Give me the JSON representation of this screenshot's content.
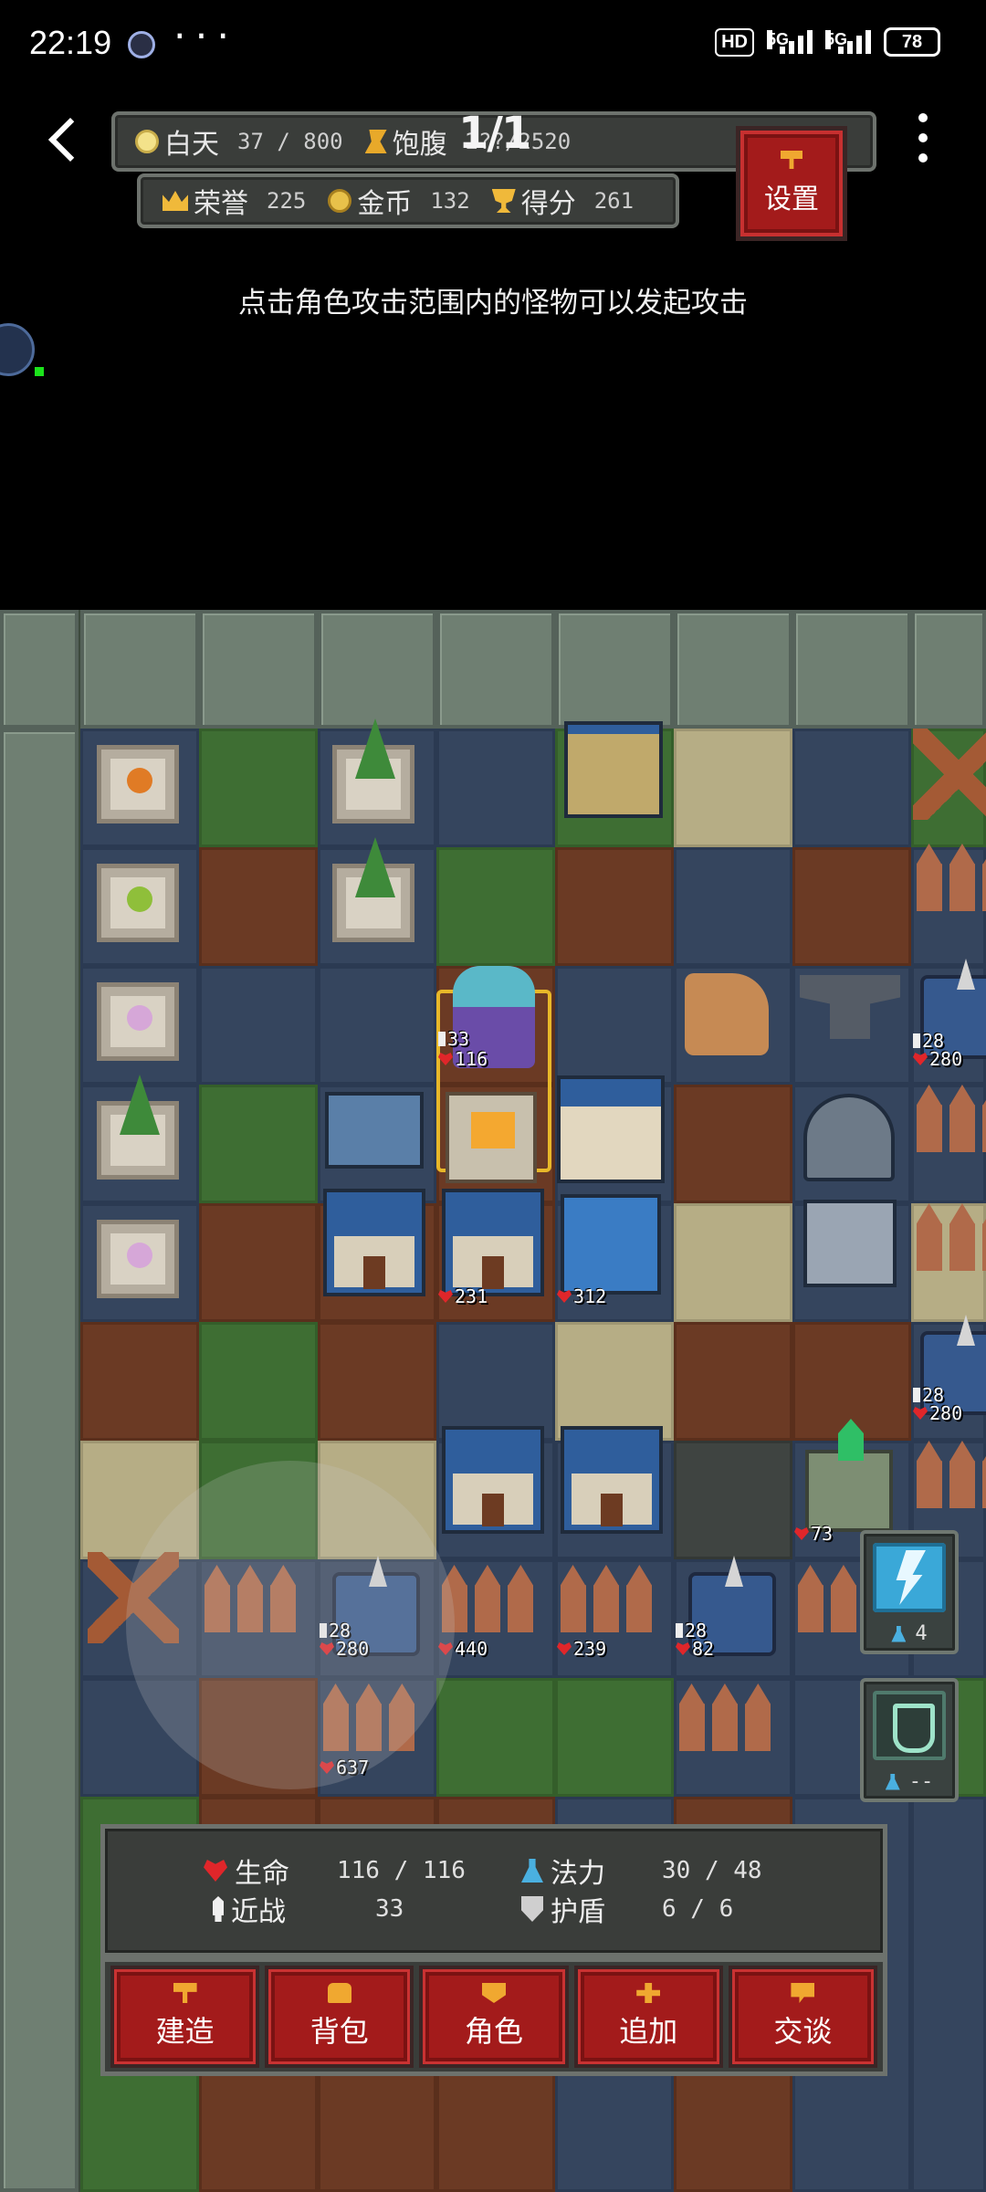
{
  "status_bar": {
    "time": "22:19",
    "dots": "···",
    "hd": "HD",
    "net1": "5G",
    "net2": "5G",
    "battery": "78"
  },
  "hud": {
    "day_label": "白天",
    "day_value": "37 / 800",
    "satiety_label": "饱腹",
    "satiety_value": "2??/2520",
    "page_indicator": "1/1",
    "honor_label": "荣誉",
    "honor_value": "225",
    "gold_label": "金币",
    "gold_value": "132",
    "score_label": "得分",
    "score_value": "261",
    "settings_label": "设置"
  },
  "hint": "点击角色攻击范围内的怪物可以发起攻击",
  "board": {
    "player": {
      "attack": "33",
      "hp": "116"
    },
    "labels": {
      "house_left_hp": "231",
      "house_right_hp": "312",
      "tower_r1_atk": "28",
      "tower_r1_hp": "280",
      "tower_r2_atk": "28",
      "tower_r2_hp": "280",
      "shrine_hp": "73",
      "tower_b1_atk": "28",
      "tower_b1_hp": "280",
      "fence_b1_hp": "440",
      "fence_b2_hp": "239",
      "tower_b2_atk": "28",
      "tower_b2_hp": "82",
      "fence_b3_hp": "637"
    },
    "skills": [
      {
        "name": "lightning",
        "count": "4"
      },
      {
        "name": "shield",
        "count": "--"
      }
    ]
  },
  "stats": {
    "hp_label": "生命",
    "hp_value": "116 / 116",
    "mp_label": "法力",
    "mp_value": "30 / 48",
    "melee_label": "近战",
    "melee_value": "33",
    "shield_label": "护盾",
    "shield_value": "6 / 6"
  },
  "actions": [
    {
      "label": "建造",
      "icon": "hammer-icon"
    },
    {
      "label": "背包",
      "icon": "bag-icon"
    },
    {
      "label": "角色",
      "icon": "character-icon"
    },
    {
      "label": "追加",
      "icon": "plus-icon"
    },
    {
      "label": "交谈",
      "icon": "chat-icon"
    }
  ],
  "colors": {
    "button_red": "#a31b1b",
    "panel": "#3a3d3a",
    "hp_heart": "#e0262a",
    "mana": "#4ab0e0"
  }
}
